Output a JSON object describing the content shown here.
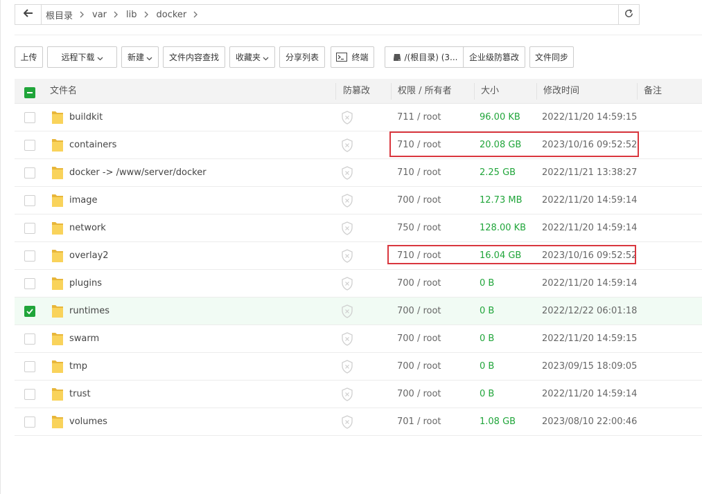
{
  "breadcrumb": [
    "根目录",
    "var",
    "lib",
    "docker"
  ],
  "toolbar": {
    "upload": "上传",
    "remote_download": "远程下载",
    "new": "新建",
    "content_search": "文件内容查找",
    "favorites": "收藏夹",
    "share_list": "分享列表",
    "terminal": "终端",
    "disk": "/(根目录) (3...",
    "tamper_protect": "企业级防篡改",
    "file_sync": "文件同步"
  },
  "table": {
    "headers": {
      "name": "文件名",
      "tamper": "防篡改",
      "perm_owner": "权限 / 所有者",
      "size": "大小",
      "mtime": "修改时间",
      "note": "备注"
    },
    "rows": [
      {
        "name": "buildkit",
        "perm": "711 / root",
        "size": "96.00 KB",
        "mtime": "2022/11/20 14:59:15",
        "checked": false
      },
      {
        "name": "containers",
        "perm": "710 / root",
        "size": "20.08 GB",
        "mtime": "2023/10/16 09:52:52",
        "checked": false
      },
      {
        "name": "docker -> /www/server/docker",
        "perm": "710 / root",
        "size": "2.25 GB",
        "mtime": "2022/11/21 13:38:27",
        "checked": false
      },
      {
        "name": "image",
        "perm": "700 / root",
        "size": "12.73 MB",
        "mtime": "2022/11/20 14:59:14",
        "checked": false
      },
      {
        "name": "network",
        "perm": "750 / root",
        "size": "128.00 KB",
        "mtime": "2022/11/20 14:59:14",
        "checked": false
      },
      {
        "name": "overlay2",
        "perm": "710 / root",
        "size": "16.04 GB",
        "mtime": "2023/10/16 09:52:52",
        "checked": false
      },
      {
        "name": "plugins",
        "perm": "700 / root",
        "size": "0 B",
        "mtime": "2022/11/20 14:59:14",
        "checked": false
      },
      {
        "name": "runtimes",
        "perm": "700 / root",
        "size": "0 B",
        "mtime": "2022/12/22 06:01:18",
        "checked": true
      },
      {
        "name": "swarm",
        "perm": "700 / root",
        "size": "0 B",
        "mtime": "2022/11/20 14:59:15",
        "checked": false
      },
      {
        "name": "tmp",
        "perm": "700 / root",
        "size": "0 B",
        "mtime": "2023/09/15 18:09:05",
        "checked": false
      },
      {
        "name": "trust",
        "perm": "700 / root",
        "size": "0 B",
        "mtime": "2022/11/20 14:59:14",
        "checked": false
      },
      {
        "name": "volumes",
        "perm": "701 / root",
        "size": "1.08 GB",
        "mtime": "2023/08/10 22:00:46",
        "checked": false
      }
    ]
  },
  "colors": {
    "accent": "#20a53a",
    "highlight": "#d9363e"
  }
}
